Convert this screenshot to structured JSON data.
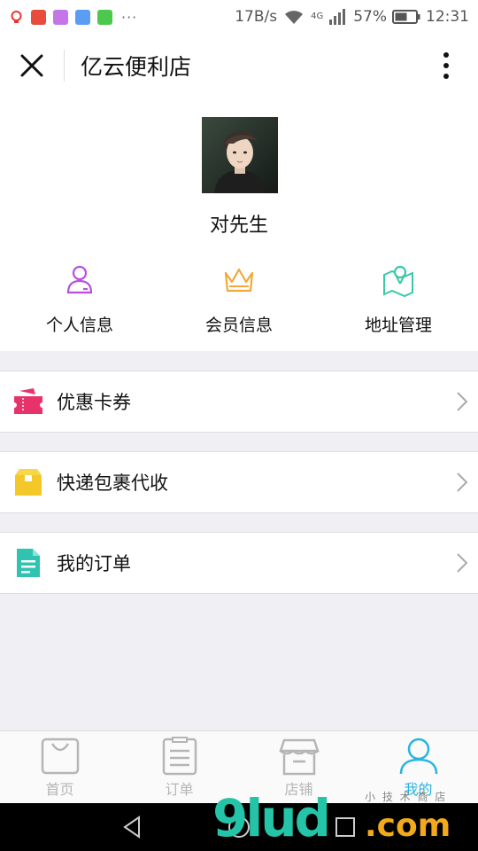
{
  "status_bar": {
    "net_speed": "17B/s",
    "network_type": "4G",
    "battery_percent": "57%",
    "time": "12:31",
    "overflow": "···",
    "app_icons": [
      "weibo-icon",
      "red-app-icon",
      "gallery-icon",
      "wifi-app-icon",
      "wechat-icon"
    ]
  },
  "header": {
    "title": "亿云便利店",
    "close_icon": "close-icon",
    "more_icon": "more-vertical-icon"
  },
  "profile": {
    "user_name": "对先生",
    "quick_links": [
      {
        "label": "个人信息",
        "icon": "person-icon",
        "color": "#b84fe0"
      },
      {
        "label": "会员信息",
        "icon": "crown-icon",
        "color": "#f0a93a"
      },
      {
        "label": "地址管理",
        "icon": "map-pin-icon",
        "color": "#3cc8a8"
      }
    ]
  },
  "menu": [
    {
      "label": "优惠卡券",
      "icon": "coupon-icon",
      "color": "#e8336a"
    },
    {
      "label": "快递包裹代收",
      "icon": "package-icon",
      "color": "#f5c82a"
    },
    {
      "label": "我的订单",
      "icon": "order-document-icon",
      "color": "#2fc4b2"
    }
  ],
  "tab_bar": [
    {
      "label": "首页",
      "icon": "shopping-bag-icon",
      "active": false
    },
    {
      "label": "订单",
      "icon": "clipboard-icon",
      "active": false
    },
    {
      "label": "店铺",
      "icon": "store-icon",
      "active": false
    },
    {
      "label": "我的",
      "icon": "person-icon",
      "active": true
    }
  ],
  "colors": {
    "active_tab": "#28b5e0",
    "inactive_tab": "#b5b5b5",
    "background": "#efeff4"
  },
  "watermark": {
    "main": "9lud",
    "domain": ".com",
    "small": "小 技 术 商 店"
  }
}
